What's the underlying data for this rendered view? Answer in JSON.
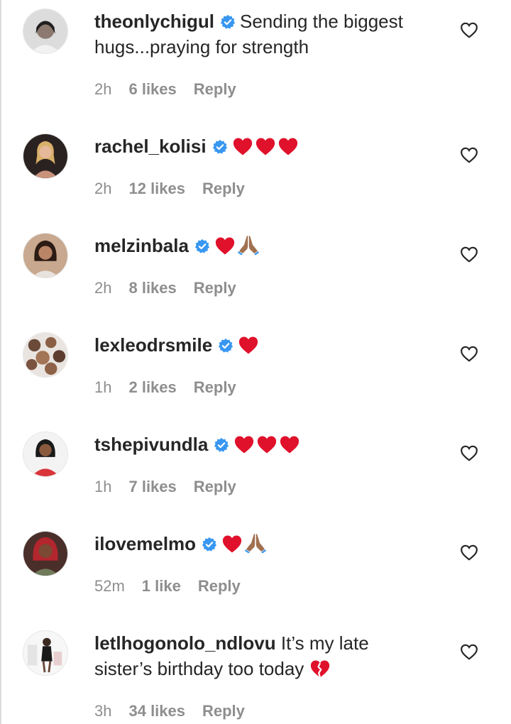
{
  "comments": [
    {
      "username": "theonlychigul",
      "verified": true,
      "text": "Sending the biggest hugs...praying for strength",
      "emojis": [],
      "time": "2h",
      "likes": "6 likes",
      "reply": "Reply"
    },
    {
      "username": "rachel_kolisi",
      "verified": true,
      "text": "",
      "emojis": [
        "red-heart",
        "red-heart",
        "red-heart"
      ],
      "time": "2h",
      "likes": "12 likes",
      "reply": "Reply"
    },
    {
      "username": "melzinbala",
      "verified": true,
      "text": "",
      "emojis": [
        "red-heart",
        "folded-hands"
      ],
      "time": "2h",
      "likes": "8 likes",
      "reply": "Reply"
    },
    {
      "username": "lexleodrsmile",
      "verified": true,
      "text": "",
      "emojis": [
        "red-heart"
      ],
      "time": "1h",
      "likes": "2 likes",
      "reply": "Reply"
    },
    {
      "username": "tshepivundla",
      "verified": true,
      "text": "",
      "emojis": [
        "red-heart",
        "red-heart",
        "red-heart"
      ],
      "time": "1h",
      "likes": "7 likes",
      "reply": "Reply"
    },
    {
      "username": "ilovemelmo",
      "verified": true,
      "text": "",
      "emojis": [
        "red-heart",
        "folded-hands"
      ],
      "time": "52m",
      "likes": "1 like",
      "reply": "Reply"
    },
    {
      "username": "letlhogonolo_ndlovu",
      "verified": false,
      "text": "It’s my late sister’s birthday too today",
      "emojis": [
        "broken-heart"
      ],
      "time": "3h",
      "likes": "34 likes",
      "reply": "Reply"
    }
  ],
  "colors": {
    "text": "#262626",
    "meta": "#8e8e8e",
    "verified": "#3897f0",
    "heart": "#e0112b",
    "skin": "#a0704f"
  }
}
